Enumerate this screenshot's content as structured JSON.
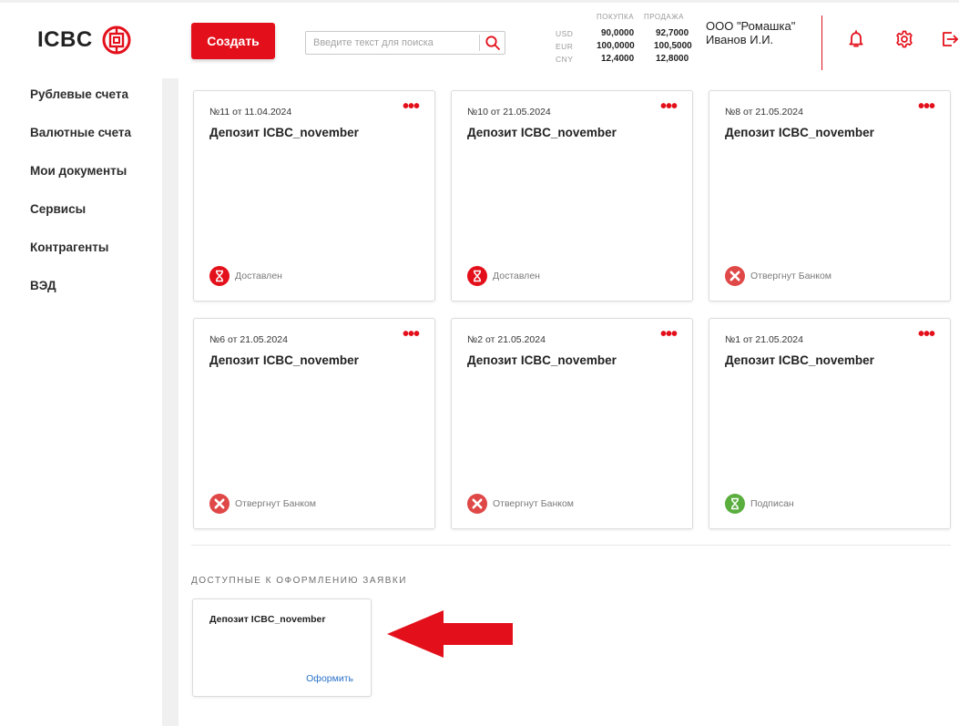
{
  "header": {
    "logo_text": "ICBC",
    "create_label": "Создать",
    "search_placeholder": "Введите текст для поиска",
    "rates": {
      "buy_header": "ПОКУПКА",
      "sell_header": "ПРОДАЖА",
      "rows": [
        {
          "currency": "USD",
          "buy": "90,0000",
          "sell": "92,7000"
        },
        {
          "currency": "EUR",
          "buy": "100,0000",
          "sell": "100,5000"
        },
        {
          "currency": "CNY",
          "buy": "12,4000",
          "sell": "12,8000"
        }
      ]
    },
    "company": "ООО \"Ромашка\"",
    "user": "Иванов И.И.",
    "icons": [
      "bell-icon",
      "gear-icon",
      "logout-icon"
    ]
  },
  "sidebar": {
    "items": [
      {
        "label": "Рублевые счета"
      },
      {
        "label": "Валютные счета"
      },
      {
        "label": "Мои документы"
      },
      {
        "label": "Сервисы"
      },
      {
        "label": "Контрагенты"
      },
      {
        "label": "ВЭД"
      }
    ]
  },
  "cards": [
    {
      "number": "№11 от 11.04.2024",
      "title": "Депозит ICBC_november",
      "status": "Доставлен",
      "status_type": "delivered",
      "status_icon": "hourglass-icon"
    },
    {
      "number": "№10 от 21.05.2024",
      "title": "Депозит ICBC_november",
      "status": "Доставлен",
      "status_type": "delivered",
      "status_icon": "hourglass-icon"
    },
    {
      "number": "№8 от 21.05.2024",
      "title": "Депозит ICBC_november",
      "status": "Отвергнут Банком",
      "status_type": "rejected",
      "status_icon": "x-circle-icon"
    },
    {
      "number": "№6 от 21.05.2024",
      "title": "Депозит ICBC_november",
      "status": "Отвергнут Банком",
      "status_type": "rejected",
      "status_icon": "x-circle-icon"
    },
    {
      "number": "№2 от 21.05.2024",
      "title": "Депозит ICBC_november",
      "status": "Отвергнут Банком",
      "status_type": "rejected",
      "status_icon": "x-circle-icon"
    },
    {
      "number": "№1 от 21.05.2024",
      "title": "Депозит ICBC_november",
      "status": "Подписан",
      "status_type": "signed",
      "status_icon": "hourglass-icon"
    }
  ],
  "more_label": "•••",
  "available": {
    "title": "ДОСТУПНЫЕ К ОФОРМЛЕНИЮ ЗАЯВКИ",
    "items": [
      {
        "title": "Депозит ICBC_november",
        "action": "Оформить"
      }
    ]
  },
  "colors": {
    "accent": "#e3101b",
    "delivered": "#e3101b",
    "rejected": "#e04848",
    "signed": "#5aae3e",
    "link": "#2b72c8"
  }
}
